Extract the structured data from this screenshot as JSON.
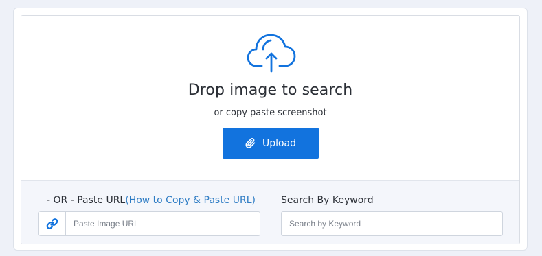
{
  "dropzone": {
    "title": "Drop image to search",
    "subtitle": "or copy paste screenshot",
    "upload_label": "Upload",
    "icon": "cloud-upload-icon"
  },
  "url_search": {
    "label_prefix": "- OR - Paste URL",
    "help_link": "(How to Copy & Paste URL)",
    "placeholder": "Paste Image URL",
    "value": "",
    "icon": "link-icon"
  },
  "keyword_search": {
    "label": "Search By Keyword",
    "placeholder": "Search by Keyword",
    "value": ""
  },
  "colors": {
    "accent": "#1273de",
    "link": "#2e7cc4",
    "page_background": "#eef1f8"
  }
}
